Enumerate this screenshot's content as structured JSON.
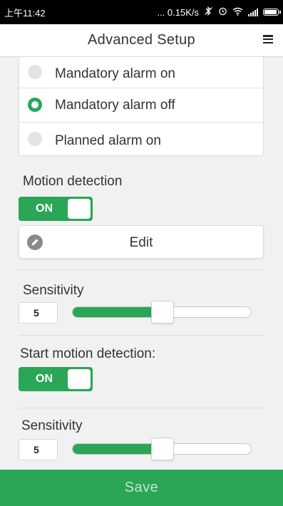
{
  "status_bar": {
    "time": "上午11:42",
    "network_speed": "... 0.15K/s",
    "icons": [
      "bluetooth-off-icon",
      "alarm-clock-icon",
      "wifi-icon",
      "cell-signal-icon",
      "battery-icon"
    ]
  },
  "header": {
    "title": "Advanced Setup",
    "menu_icon": "hamburger-menu-icon"
  },
  "alarm_options": [
    {
      "label": "Mandatory alarm on",
      "selected": false
    },
    {
      "label": "Mandatory alarm off",
      "selected": true
    },
    {
      "label": "Planned alarm on",
      "selected": false
    }
  ],
  "motion_detection": {
    "label": "Motion detection",
    "toggle_label": "ON",
    "toggle_on": true,
    "edit_label": "Edit",
    "edit_icon": "pencil-icon"
  },
  "sensitivity_1": {
    "label": "Sensitivity",
    "value": "5",
    "slider_fraction": 0.44
  },
  "start_motion_detection": {
    "label": "Start motion detection:",
    "toggle_label": "ON",
    "toggle_on": true
  },
  "sensitivity_2": {
    "label": "Sensitivity",
    "value": "5",
    "slider_fraction": 0.44
  },
  "save_label": "Save",
  "colors": {
    "accent": "#2aa656",
    "save_text": "#bfe8cd"
  }
}
